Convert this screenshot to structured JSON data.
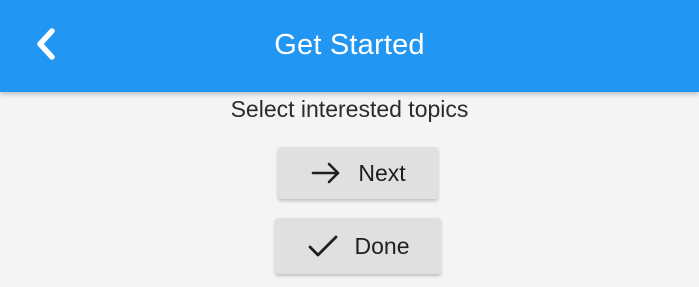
{
  "app_bar": {
    "title": "Get Started",
    "back_icon": "chevron-left-icon",
    "color": "#2196f3"
  },
  "content": {
    "subtitle": "Select interested topics",
    "next_button": {
      "label": "Next",
      "icon": "arrow-right-icon"
    },
    "done_button": {
      "label": "Done",
      "icon": "check-icon"
    }
  }
}
